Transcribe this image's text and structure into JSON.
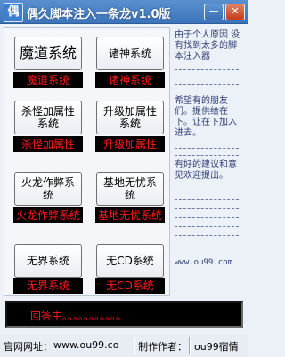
{
  "window": {
    "title": "偶久脚本注入一条龙v1.0版",
    "icon_glyph": "偶",
    "minimize_glyph": "—",
    "close_glyph": "✕"
  },
  "systems": [
    {
      "button": "魔道系统",
      "label": "魔道系统"
    },
    {
      "button": "诸神系统",
      "label": "诸神系统"
    },
    {
      "button": "杀怪加属性系统",
      "label": "杀怪加属性"
    },
    {
      "button": "升级加属性系统",
      "label": "升级加属性"
    },
    {
      "button": "火龙作弊系统",
      "label": "火龙作弊系统"
    },
    {
      "button": "基地无忧系统",
      "label": "基地无忧系统"
    },
    {
      "button": "无界系统",
      "label": "无界系统"
    },
    {
      "button": "无CD系统",
      "label": "无CD系统"
    }
  ],
  "info": {
    "paragraph1": "由于个人原因 没有找到太多的脚本注入器",
    "paragraph2": "希望有的朋友 们。提供给在下。让在下加入进去。",
    "paragraph3": "有好的建议和意见欢迎提出。",
    "site": "www.ou99.com"
  },
  "status": {
    "text": "回答中。。。。。。。。。。。"
  },
  "footer": {
    "website_label": "官网网址：",
    "website_value": "www.ou99.co",
    "author_label": "制作作者：",
    "author_value": "ou99宿情"
  },
  "colors": {
    "accent_red": "#ff1a1a",
    "titlebar": "#4a82c6"
  }
}
